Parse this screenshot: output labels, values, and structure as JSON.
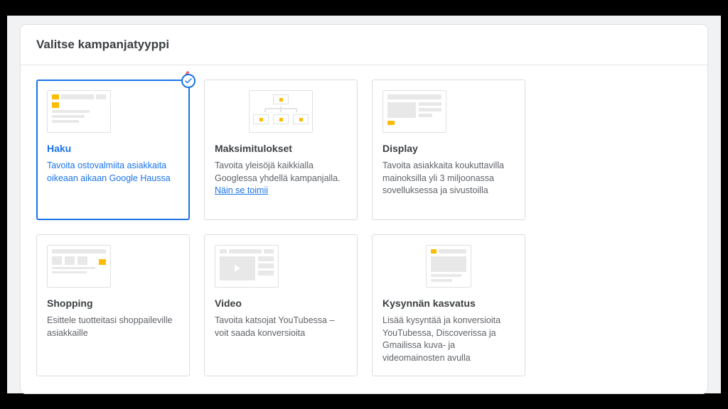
{
  "header": {
    "title": "Valitse kampanjatyyppi"
  },
  "cards": [
    {
      "id": "search",
      "title": "Haku",
      "desc": "Tavoita ostovalmiita asiakkaita oikeaan aikaan Google Haussa",
      "selected": true
    },
    {
      "id": "pmax",
      "title": "Maksimitulokset",
      "desc_pre": "Tavoita yleisöjä kaikkialla Googlessa yhdellä kampanjalla. ",
      "link": "Näin se toimii"
    },
    {
      "id": "display",
      "title": "Display",
      "desc": "Tavoita asiakkaita koukuttavilla mainoksilla yli 3 miljoonassa sovelluksessa ja sivustoilla"
    },
    {
      "id": "shopping",
      "title": "Shopping",
      "desc": "Esittele tuotteitasi shoppaileville asiakkaille"
    },
    {
      "id": "video",
      "title": "Video",
      "desc": "Tavoita katsojat YouTubessa – voit saada konversioita"
    },
    {
      "id": "demand",
      "title": "Kysynnän kasvatus",
      "desc": "Lisää kysyntää ja konversioita YouTubessa, Discoverissa ja Gmailissa kuva- ja videomainosten avulla"
    }
  ]
}
